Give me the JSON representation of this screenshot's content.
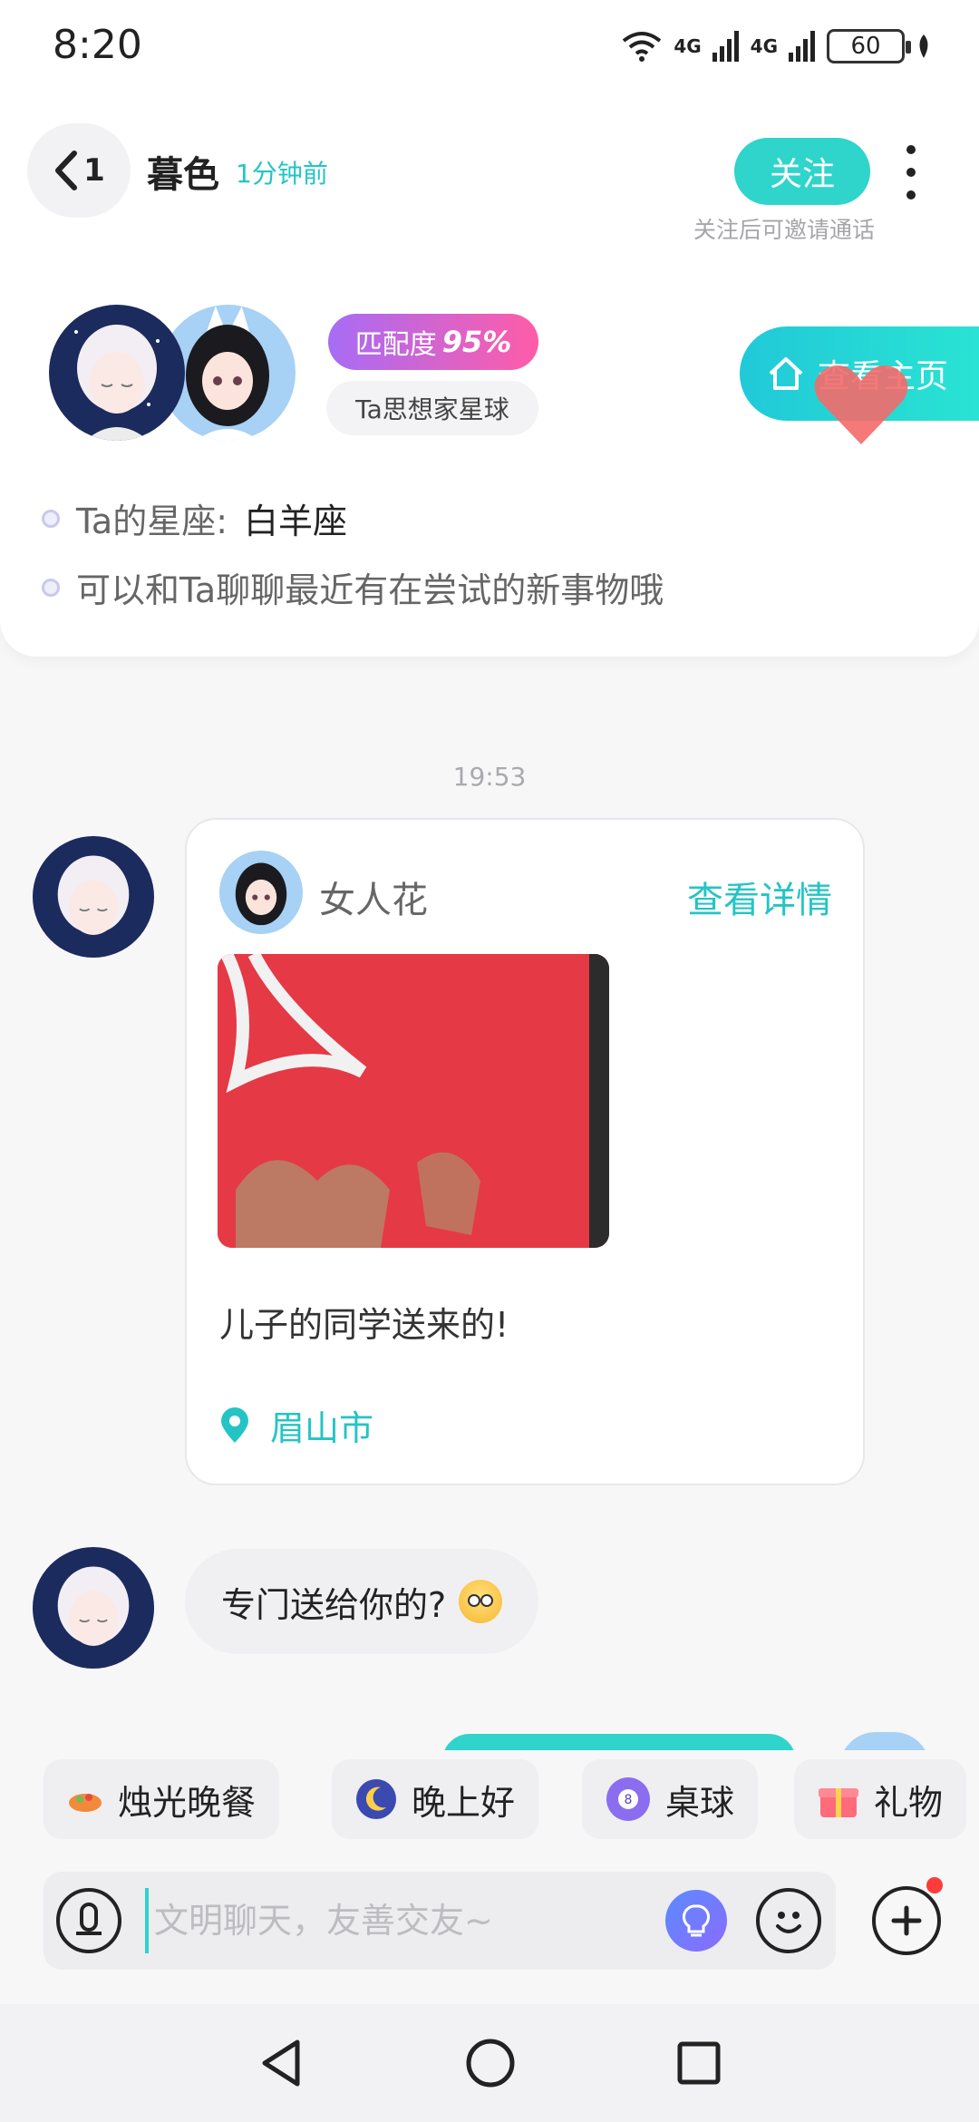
{
  "status_bar": {
    "time": "8:20",
    "network_1": "4G",
    "network_2": "4G",
    "battery": "60"
  },
  "header": {
    "back_count": "1",
    "contact_name": "暮色",
    "last_active": "1分钟前",
    "follow_label": "关注",
    "follow_hint": "关注后可邀请通话"
  },
  "match_card": {
    "match_label": "匹配度",
    "match_value": "95%",
    "planet_tag": "Ta思想家星球",
    "view_profile_label": "查看主页",
    "tips": [
      {
        "label": "Ta的星座:",
        "value": "白羊座"
      },
      {
        "label": "可以和Ta聊聊最近有在尝试的新事物哦",
        "value": ""
      }
    ]
  },
  "chat": {
    "timestamp": "19:53",
    "share_card": {
      "author": "女人花",
      "details_link": "查看详情",
      "caption": "儿子的同学送来的!",
      "location": "眉山市"
    },
    "message": {
      "text": "专门送给你的?",
      "emoji_icon": "smiling-face-icon"
    }
  },
  "quick_replies": [
    {
      "label": "烛光晚餐",
      "icon": "dinner-icon"
    },
    {
      "label": "晚上好",
      "icon": "moon-icon"
    },
    {
      "label": "桌球",
      "icon": "billiard-ball-icon"
    },
    {
      "label": "礼物",
      "icon": "gift-icon"
    }
  ],
  "input": {
    "placeholder": "文明聊天，友善交友~"
  },
  "colors": {
    "accent": "#2fd4cb",
    "accent_text": "#25c4c4",
    "badge_red": "#ff3b3b"
  }
}
